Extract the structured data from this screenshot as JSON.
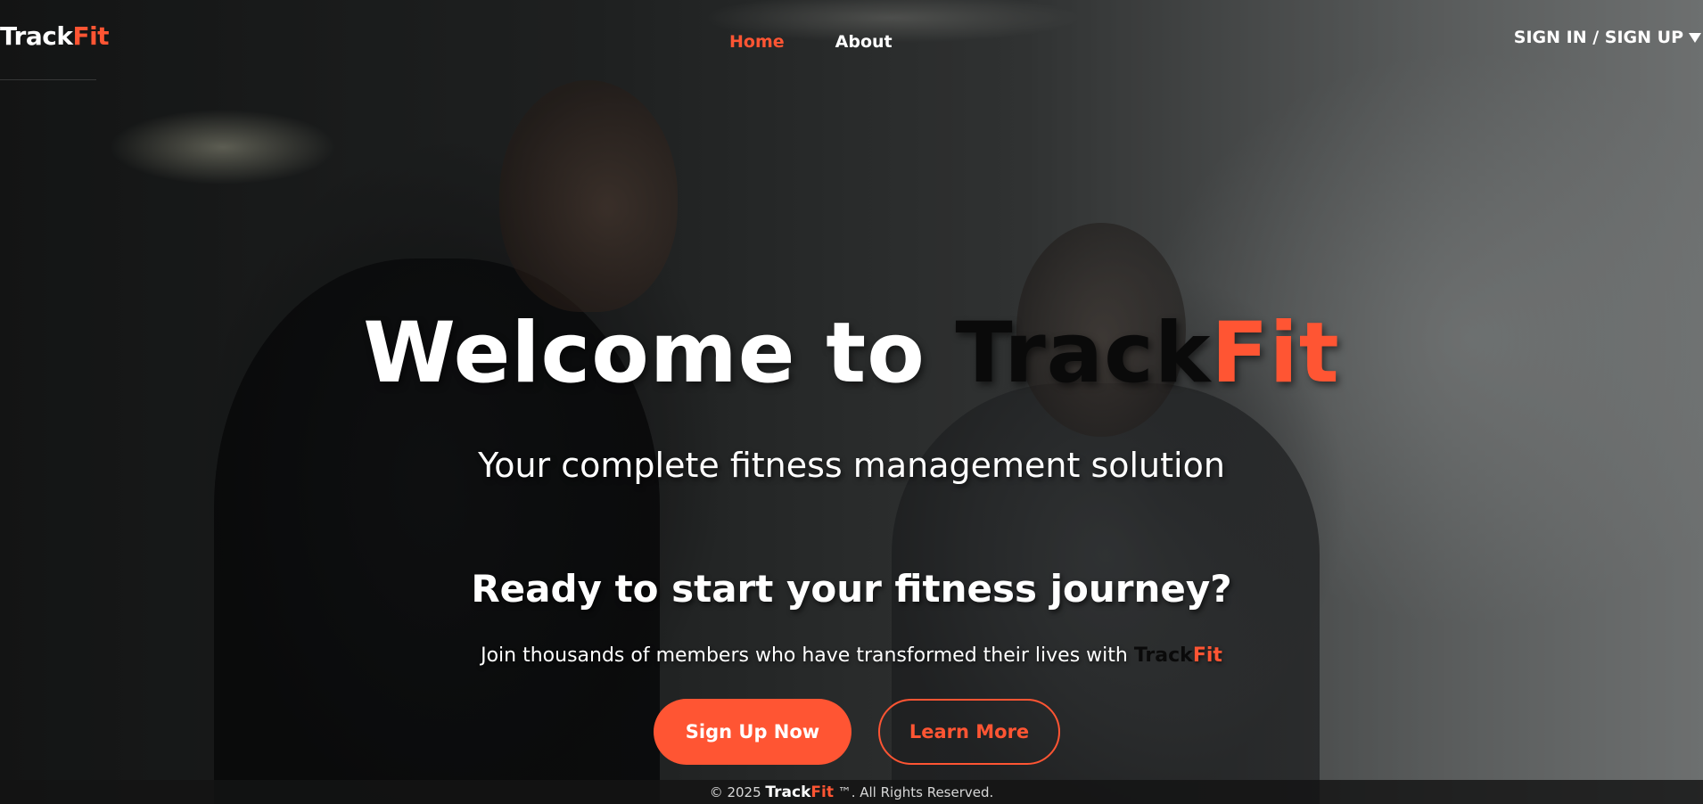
{
  "brand": {
    "name_part1": "Track",
    "name_part2": "Fit",
    "accent_color": "#ff5533"
  },
  "header": {
    "nav": [
      {
        "label": "Home",
        "active": true
      },
      {
        "label": "About",
        "active": false
      }
    ],
    "auth_label": "SIGN IN / SIGN UP",
    "auth_icon": "caret-down-icon"
  },
  "hero": {
    "title_prefix": "Welcome to ",
    "subtitle": "Your complete fitness management solution",
    "cta_heading": "Ready to start your fitness journey?",
    "cta_text": "Join thousands of members who have transformed their lives with ",
    "primary_button": "Sign Up Now",
    "secondary_button": "Learn More"
  },
  "footer": {
    "prefix": "© 2025 ",
    "suffix": " ™. All Rights Reserved."
  }
}
